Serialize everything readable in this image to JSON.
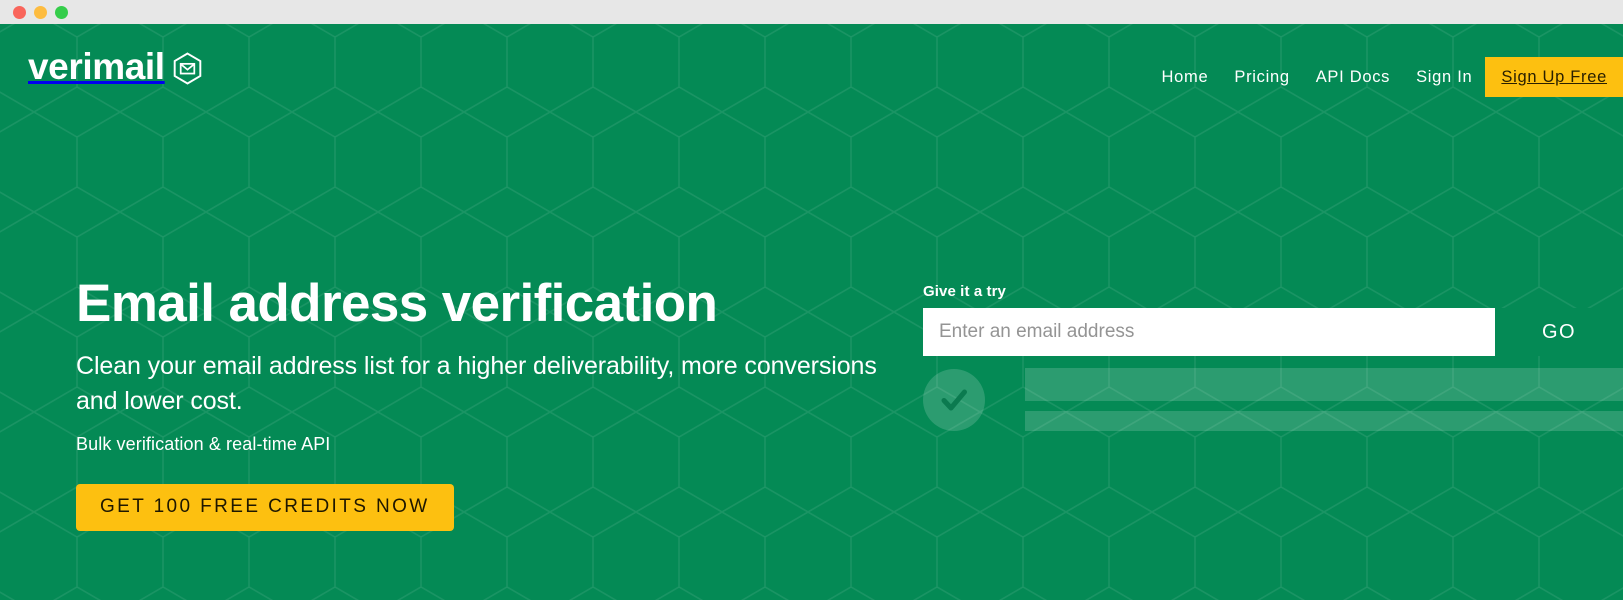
{
  "window": {
    "titlebar_buttons": [
      {
        "name": "close",
        "color": "#f9655b"
      },
      {
        "name": "minimize",
        "color": "#fdbc40"
      },
      {
        "name": "maximize",
        "color": "#35cd4b"
      }
    ]
  },
  "theme": {
    "brand_green": "#048a55",
    "accent_yellow": "#FDC010",
    "text_on_accent": "#1e1700",
    "text_white": "#ffffff"
  },
  "nav": {
    "logo_text": "verimail",
    "logo_icon": "hexagon-envelope-icon",
    "links": [
      {
        "label": "Home"
      },
      {
        "label": "Pricing"
      },
      {
        "label": "API Docs"
      },
      {
        "label": "Sign In"
      }
    ],
    "cta_label": "Sign Up Free"
  },
  "hero": {
    "headline": "Email address verification",
    "subhead": "Clean your email address list for a higher deliverability, more conversions and lower cost.",
    "tagline": "Bulk verification & real-time API",
    "cta_label": "GET 100 FREE CREDITS NOW"
  },
  "try_widget": {
    "label": "Give it a try",
    "input_placeholder": "Enter an email address",
    "input_value": "",
    "go_label": "GO",
    "result": {
      "status_icon": "check-circle-icon",
      "placeholder_lines": 2
    }
  }
}
